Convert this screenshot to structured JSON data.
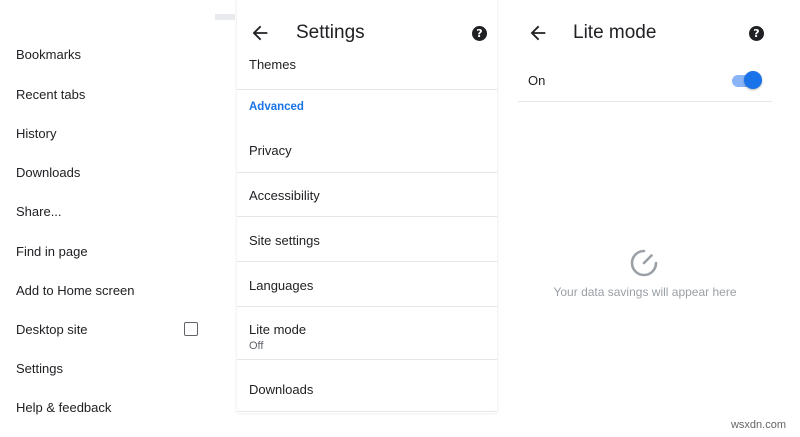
{
  "menu": {
    "items": [
      {
        "label": "Bookmarks"
      },
      {
        "label": "Recent tabs"
      },
      {
        "label": "History"
      },
      {
        "label": "Downloads"
      },
      {
        "label": "Share..."
      },
      {
        "label": "Find in page"
      },
      {
        "label": "Add to Home screen"
      },
      {
        "label": "Desktop site",
        "checked": false
      },
      {
        "label": "Settings"
      },
      {
        "label": "Help & feedback"
      }
    ]
  },
  "settings": {
    "title": "Settings",
    "help_symbol": "?",
    "section_header": "Advanced",
    "rows": [
      {
        "label": "Themes"
      },
      {
        "label": "Privacy"
      },
      {
        "label": "Accessibility"
      },
      {
        "label": "Site settings"
      },
      {
        "label": "Languages"
      },
      {
        "label": "Lite mode",
        "sub": "Off"
      },
      {
        "label": "Downloads"
      }
    ]
  },
  "lite_mode": {
    "title": "Lite mode",
    "help_symbol": "?",
    "switch_label": "On",
    "switch_on": true,
    "empty_message": "Your data savings will appear here"
  },
  "watermark": "wsxdn.com",
  "colors": {
    "accent": "#1a73e8",
    "toggle_track": "#8ab4f8",
    "muted_text": "#9aa0a6"
  },
  "icons": {
    "back": "arrow-left-icon",
    "help": "help-circle-icon",
    "gauge": "speedometer-icon",
    "checkbox": "checkbox-unchecked-icon"
  }
}
